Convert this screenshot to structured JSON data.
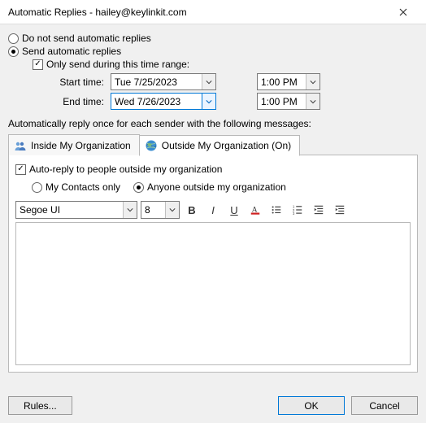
{
  "title": "Automatic Replies - hailey@keylinkit.com",
  "radios": {
    "dont_send": "Do not send automatic replies",
    "send": "Send automatic replies"
  },
  "range": {
    "check": "Only send during this time range:",
    "start_label": "Start time:",
    "end_label": "End time:",
    "start_date": "Tue 7/25/2023",
    "end_date": "Wed 7/26/2023",
    "start_time": "1:00 PM",
    "end_time": "1:00 PM"
  },
  "section_label": "Automatically reply once for each sender with the following messages:",
  "tabs": {
    "inside": "Inside My Organization",
    "outside": "Outside My Organization (On)"
  },
  "outside": {
    "check": "Auto-reply to people outside my organization",
    "contacts_only": "My Contacts only",
    "anyone": "Anyone outside my organization"
  },
  "toolbar": {
    "font": "Segoe UI",
    "size": "8"
  },
  "buttons": {
    "rules": "Rules...",
    "ok": "OK",
    "cancel": "Cancel"
  }
}
